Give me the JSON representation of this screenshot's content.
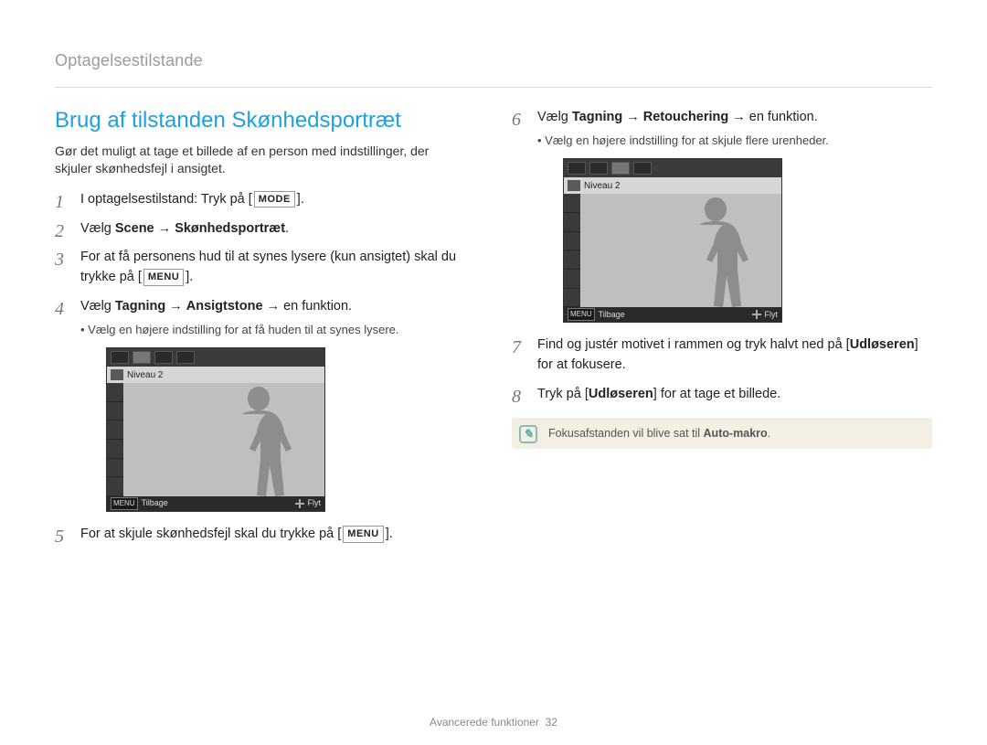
{
  "header": {
    "section": "Optagelsestilstande"
  },
  "title": "Brug af tilstanden Skønhedsportræt",
  "intro": "Gør det muligt at tage et billede af en person med indstillinger, der skjuler skønhedsfejl i ansigtet.",
  "buttons": {
    "mode": "MODE",
    "menu": "MENU"
  },
  "steps_left": {
    "s1_pre": "I optagelsestilstand: Tryk på [",
    "s1_post": "].",
    "s2_pre": "Vælg ",
    "s2_b1": "Scene",
    "s2_arrow": " → ",
    "s2_b2": "Skønhedsportræt",
    "s2_post": ".",
    "s3_pre": "For at få personens hud til at synes lysere (kun ansigtet) skal du trykke på [",
    "s3_post": "].",
    "s4_pre": "Vælg ",
    "s4_b1": "Tagning",
    "s4_arrow1": " → ",
    "s4_b2": "Ansigtstone",
    "s4_arrow2": " → en funktion.",
    "s4_sub": "Vælg en højere indstilling for at få huden til at synes lysere.",
    "s5_pre": "For at skjule skønhedsfejl skal du trykke på [",
    "s5_post": "]."
  },
  "steps_right": {
    "s6_pre": "Vælg ",
    "s6_b1": "Tagning",
    "s6_arrow1": " → ",
    "s6_b2": "Retouchering",
    "s6_arrow2": " → en funktion.",
    "s6_sub": "Vælg en højere indstilling for at skjule flere urenheder.",
    "s7_pre": "Find og justér motivet i rammen og tryk halvt ned på [",
    "s7_b": "Udløseren",
    "s7_post": "] for at fokusere.",
    "s8_pre": "Tryk på [",
    "s8_b": "Udløseren",
    "s8_post": "] for at tage et billede."
  },
  "screenshot": {
    "level_label": "Niveau 2",
    "back": "Tilbage",
    "move": "Flyt",
    "menu": "MENU"
  },
  "note": {
    "pre": "Fokusafstanden vil blive sat til ",
    "b": "Auto-makro",
    "post": "."
  },
  "footer": {
    "label": "Avancerede funktioner",
    "page": "32"
  }
}
